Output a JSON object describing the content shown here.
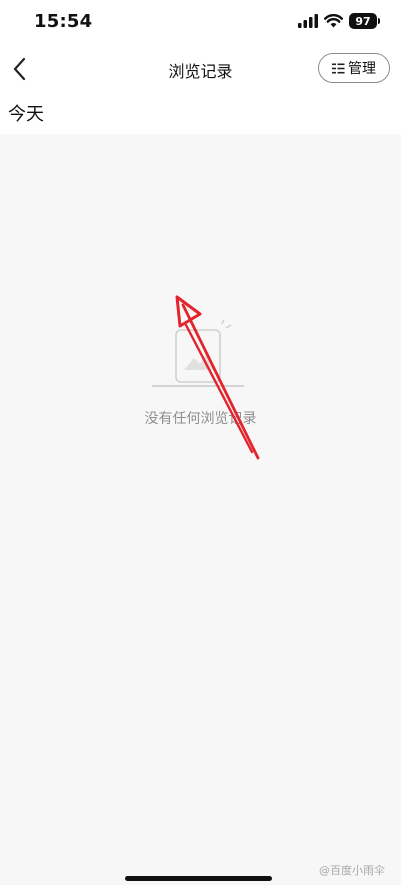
{
  "status_bar": {
    "time": "15:54",
    "battery": "97"
  },
  "nav": {
    "title": "浏览记录",
    "manage_label": "管理",
    "back_icon": "chevron-left-icon",
    "manage_icon": "list-icon"
  },
  "section": {
    "header": "今天"
  },
  "empty_state": {
    "message": "没有任何浏览记录",
    "icon": "empty-document-icon"
  },
  "annotation": {
    "color": "#e3242b",
    "icon": "arrow-icon"
  },
  "watermark": {
    "text": "@百度小雨伞"
  }
}
